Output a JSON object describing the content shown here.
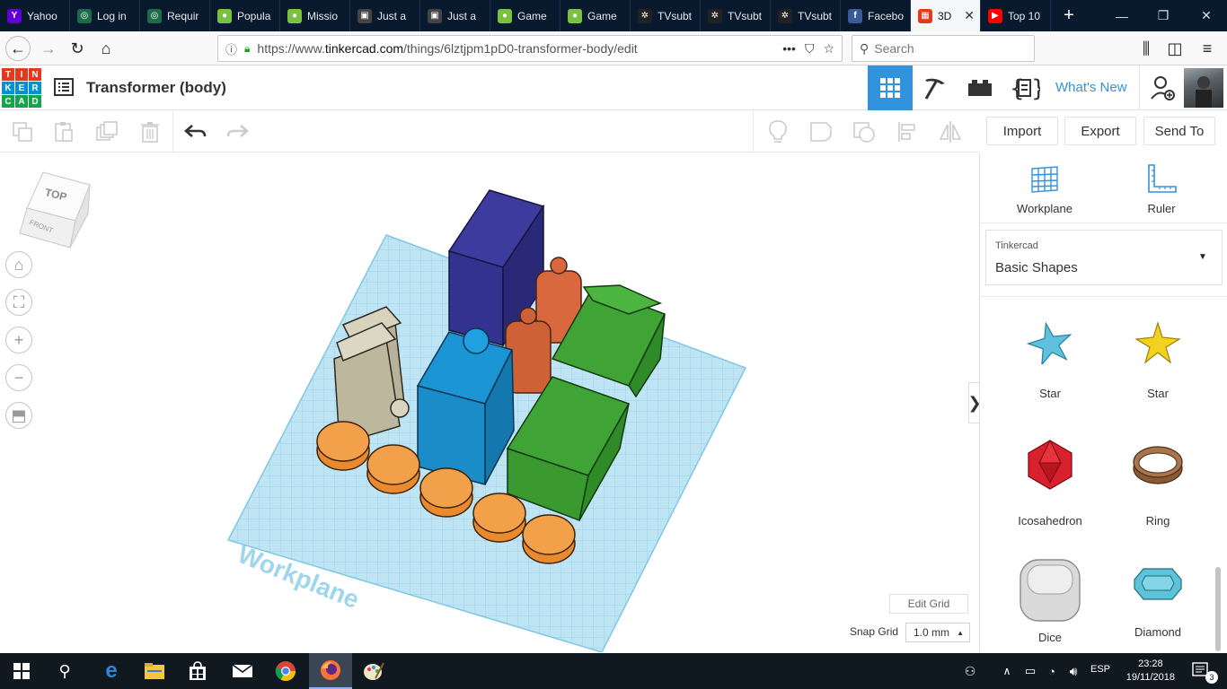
{
  "browser": {
    "tabs": [
      {
        "label": "Yahoo",
        "icon": "yahoo-icon",
        "color": "#5f01d1",
        "glyph": "Y"
      },
      {
        "label": "Log in",
        "icon": "globe-icon",
        "color": "#1e6b4a",
        "glyph": "◎"
      },
      {
        "label": "Requir",
        "icon": "globe-icon",
        "color": "#1e6b4a",
        "glyph": "◎"
      },
      {
        "label": "Popula",
        "icon": "green-dot-icon",
        "color": "#7ac142",
        "glyph": "●"
      },
      {
        "label": "Missio",
        "icon": "green-dot-icon",
        "color": "#7ac142",
        "glyph": "●"
      },
      {
        "label": "Just a",
        "icon": "page-icon",
        "color": "#444",
        "glyph": "▣"
      },
      {
        "label": "Just a",
        "icon": "page-icon",
        "color": "#444",
        "glyph": "▣"
      },
      {
        "label": "Game",
        "icon": "green-dot-icon",
        "color": "#7ac142",
        "glyph": "●"
      },
      {
        "label": "Game",
        "icon": "green-dot-icon",
        "color": "#7ac142",
        "glyph": "●"
      },
      {
        "label": "TVsubt",
        "icon": "film-icon",
        "color": "#222",
        "glyph": "✲"
      },
      {
        "label": "TVsubt",
        "icon": "film-icon",
        "color": "#222",
        "glyph": "✲"
      },
      {
        "label": "TVsubt",
        "icon": "film-icon",
        "color": "#222",
        "glyph": "✲"
      },
      {
        "label": "Facebo",
        "icon": "facebook-icon",
        "color": "#3b5998",
        "glyph": "f"
      },
      {
        "label": "3D",
        "icon": "tinkercad-icon",
        "color": "#e4381f",
        "glyph": "▦",
        "active": true
      },
      {
        "label": "Top 10",
        "icon": "youtube-icon",
        "color": "#ff0000",
        "glyph": "▶"
      }
    ],
    "new_tab": "+",
    "url_prefix": "https://www.",
    "url_host": "tinkercad.com",
    "url_path": "/things/6lztjpm1pD0-transformer-body/edit",
    "url_dots": "•••",
    "search_placeholder": "Search"
  },
  "app": {
    "logo_letters": [
      "T",
      "I",
      "N",
      "K",
      "E",
      "R",
      "C",
      "A",
      "D"
    ],
    "logo_colors": [
      "#e4381f",
      "#e4381f",
      "#e4381f",
      "#0092d2",
      "#0092d2",
      "#0092d2",
      "#13a54a",
      "#13a54a",
      "#13a54a"
    ],
    "design_title": "Transformer (body)",
    "whats_new": "What's New",
    "accent": "#3293db"
  },
  "toolbar": {
    "import_label": "Import",
    "export_label": "Export",
    "send_to_label": "Send To"
  },
  "viewcube": {
    "top": "TOP",
    "front": "FRONT"
  },
  "workplane_text": "Workplane",
  "viewport": {
    "edit_grid": "Edit Grid",
    "snap_grid_label": "Snap Grid",
    "snap_grid_value": "1.0 mm"
  },
  "panel": {
    "workplane_label": "Workplane",
    "ruler_label": "Ruler",
    "library_owner": "Tinkercad",
    "library_name": "Basic Shapes",
    "shapes": [
      {
        "label": "Star",
        "icon": "star-blue-icon"
      },
      {
        "label": "Star",
        "icon": "star-yellow-icon"
      },
      {
        "label": "Icosahedron",
        "icon": "icosahedron-icon"
      },
      {
        "label": "Ring",
        "icon": "ring-icon"
      },
      {
        "label": "Dice",
        "icon": "dice-icon"
      },
      {
        "label": "Diamond",
        "icon": "diamond-icon"
      }
    ],
    "collapse": "❯"
  },
  "taskbar": {
    "language": "ESP",
    "time": "23:28",
    "date": "19/11/2018",
    "notification_count": "3"
  }
}
